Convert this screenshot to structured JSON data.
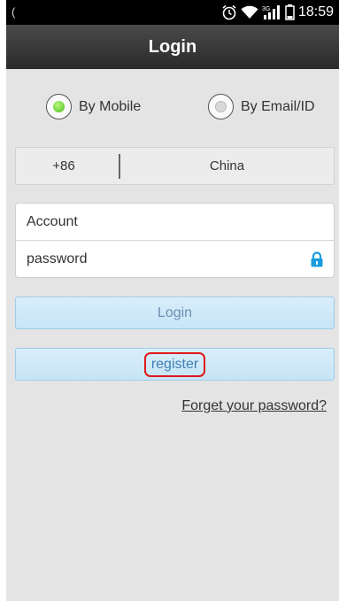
{
  "status_bar": {
    "left_glyph": "(",
    "icons": [
      "alarm-icon",
      "wifi-icon",
      "signal-3g-icon",
      "battery-icon"
    ],
    "network_label": "3G",
    "time": "18:59"
  },
  "title_bar": {
    "title": "Login"
  },
  "login_mode": {
    "options": [
      {
        "label": "By Mobile",
        "selected": true
      },
      {
        "label": "By Email/ID",
        "selected": false
      }
    ]
  },
  "country": {
    "code": "+86",
    "name": "China"
  },
  "form": {
    "account_placeholder": "Account",
    "password_placeholder": "password",
    "password_icon": "lock-icon"
  },
  "buttons": {
    "login": "Login",
    "register": "register"
  },
  "links": {
    "forgot_password": "Forget your password?"
  },
  "colors": {
    "accent_green": "#49c21a",
    "button_blue": "#c7e4f6",
    "highlight_red": "#e01818",
    "lock_blue": "#1a9cdc"
  }
}
